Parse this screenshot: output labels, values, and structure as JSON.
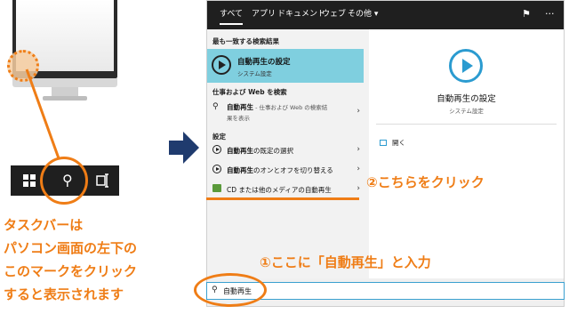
{
  "left": {
    "caption_lines": [
      "タスクバーは",
      "パソコン画面の左下の",
      "このマークをクリック",
      "すると表示されます"
    ]
  },
  "menu": {
    "tabs": [
      "すべて",
      "アプリ",
      "ドキュメント",
      "ウェブ",
      "その他 ▾"
    ],
    "best_match_header": "最も一致する検索結果",
    "best_match": {
      "title": "自動再生の設定",
      "subtitle": "システム設定"
    },
    "web_header": "仕事および Web を検索",
    "web_result": {
      "bold": "自動再生",
      "rest": " - 仕事および Web の検索結",
      "line2": "果を表示"
    },
    "settings_header": "設定",
    "settings_items": [
      {
        "bold": "自動再生",
        "rest": "の既定の選択"
      },
      {
        "bold": "自動再生",
        "rest": "のオンとオフを切り替える"
      },
      {
        "bold": "",
        "rest": "CD または他のメディアの自動再生"
      }
    ],
    "preview": {
      "title": "自動再生の設定",
      "subtitle": "システム設定",
      "open_label": "開く"
    },
    "search_value": "自動再生"
  },
  "callouts": {
    "step2": "②こちらをクリック",
    "step1": "①ここに「自動再生」と入力"
  },
  "colors": {
    "accent": "#ef7d16",
    "highlight": "#7fcfdf",
    "arrow": "#1f3b6e"
  }
}
